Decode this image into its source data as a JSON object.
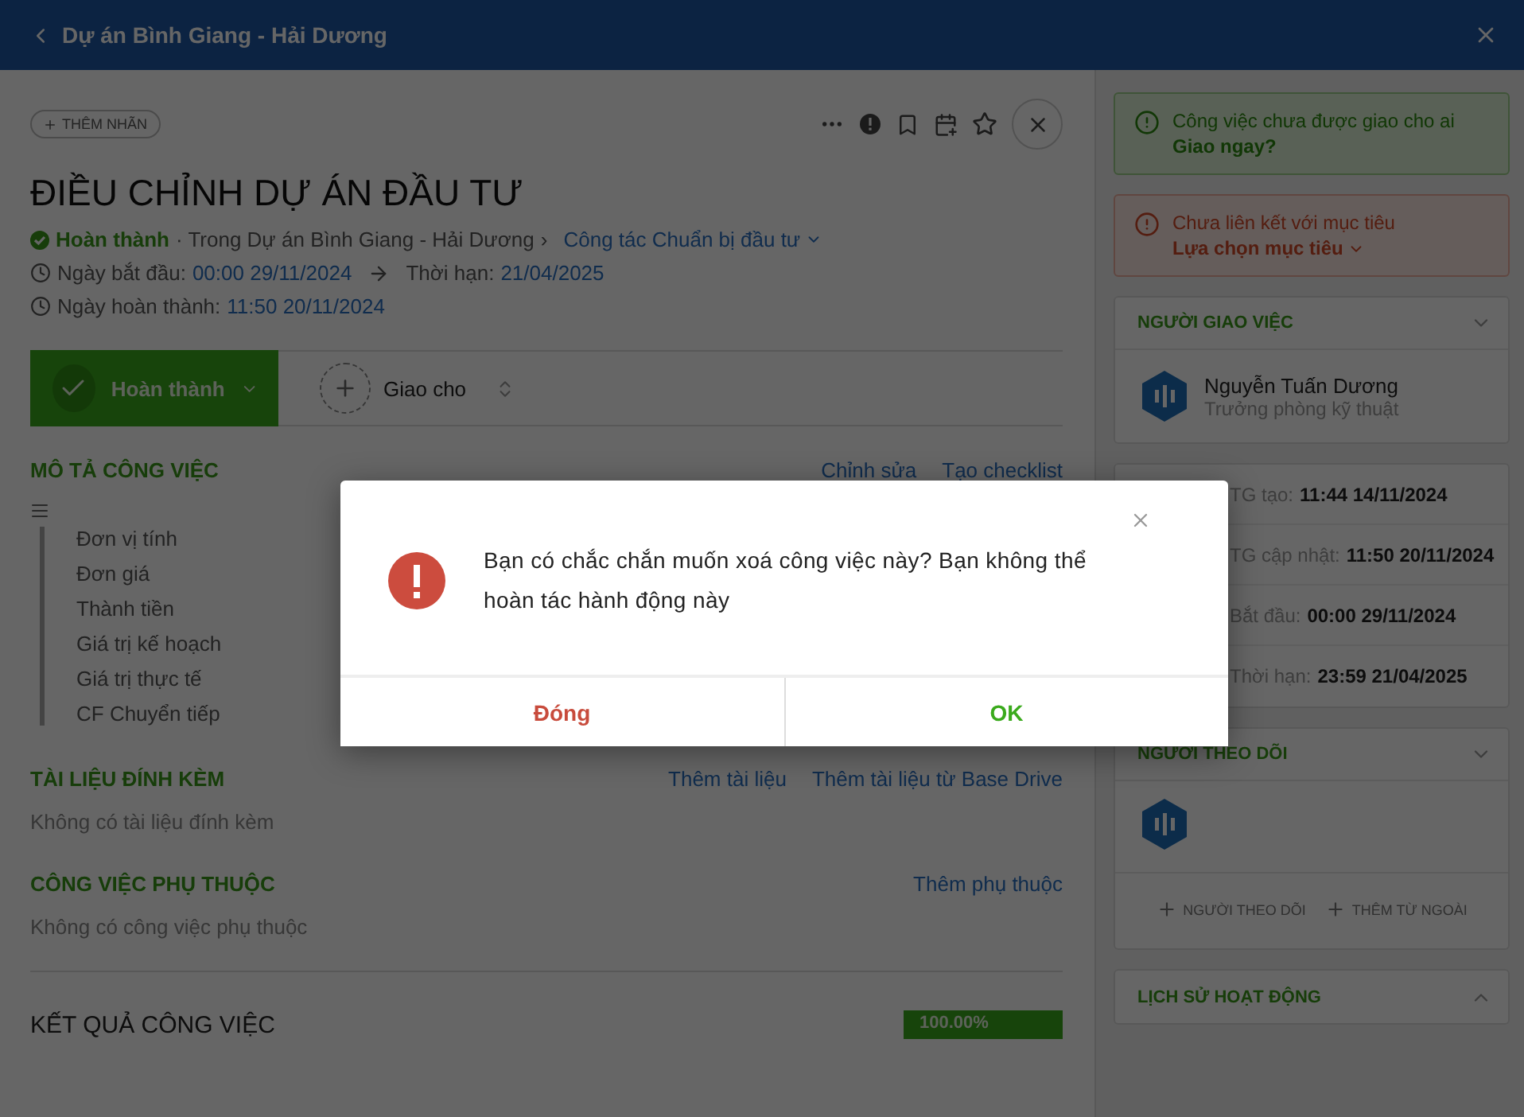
{
  "header": {
    "back_title": "Dự án Bình Giang - Hải Dương"
  },
  "task": {
    "tag_button": "THÊM NHÃN",
    "title": "ĐIỀU CHỈNH DỰ ÁN ĐẦU TƯ",
    "status": "Hoàn thành",
    "context": "· Trong Dự án Bình Giang - Hải Dương",
    "separator": "›",
    "group": "Công tác Chuẩn bị đầu tư",
    "start_label": "Ngày bắt đầu:",
    "start_value": "00:00 29/11/2024",
    "deadline_label": "Thời hạn:",
    "deadline_value": "21/04/2025",
    "done_label": "Ngày hoàn thành:",
    "done_value": "11:50 20/11/2024",
    "status_button": "Hoàn thành",
    "completed": true,
    "assign_label": "Giao cho"
  },
  "description": {
    "title": "MÔ TẢ CÔNG VIỆC",
    "actions": [
      "Chỉnh sửa",
      "Tạo checklist"
    ],
    "fields": [
      "Đơn vị tính",
      "Đơn giá",
      "Thành tiền",
      "Giá trị kế hoạch",
      "Giá trị thực tế",
      "CF Chuyển tiếp"
    ]
  },
  "attachments": {
    "title": "TÀI LIỆU ĐÍNH KÈM",
    "actions": [
      "Thêm tài liệu",
      "Thêm tài liệu từ Base Drive"
    ],
    "empty": "Không có tài liệu đính kèm"
  },
  "dependencies": {
    "title": "CÔNG VIỆC PHỤ THUỘC",
    "actions": [
      "Thêm phụ thuộc"
    ],
    "empty": "Không có công việc phụ thuộc"
  },
  "result": {
    "title": "KẾT QUẢ CÔNG VIỆC",
    "level": 1,
    "reading": "100.00%"
  },
  "alerts": [
    {
      "kind": "success",
      "text": "Công việc chưa được giao cho ai",
      "action": "Giao ngay?",
      "dropdown": false
    },
    {
      "kind": "danger",
      "text": "Chưa liên kết với mục tiêu",
      "action": "Lựa chọn mục tiêu",
      "dropdown": true
    }
  ],
  "assigner": {
    "title": "NGƯỜI GIAO VIỆC",
    "expanded": false,
    "name": "Nguyễn Tuấn Dương",
    "role": "Trưởng phòng kỹ thuật"
  },
  "times": [
    {
      "label": "TG tạo:",
      "value": "11:44 14/11/2024"
    },
    {
      "label": "TG cập nhật:",
      "value": "11:50 20/11/2024"
    },
    {
      "label": "Bắt đầu:",
      "value": "00:00 29/11/2024"
    },
    {
      "label": "Thời hạn:",
      "value": "23:59 21/04/2025"
    }
  ],
  "followers": {
    "title": "NGƯỜI THEO DÕI",
    "expanded": false,
    "actions": [
      "NGƯỜI THEO DÕI",
      "THÊM TỪ NGOÀI"
    ]
  },
  "history": {
    "title": "LỊCH SỬ HOẠT ĐỘNG",
    "expanded": true
  },
  "dialog": {
    "message": "Bạn có chắc chắn muốn xoá công việc này? Bạn không thể hoàn tác hành động này",
    "buttons": [
      {
        "kind": "cancel",
        "label": "Đóng"
      },
      {
        "kind": "confirm",
        "label": "OK"
      }
    ]
  }
}
